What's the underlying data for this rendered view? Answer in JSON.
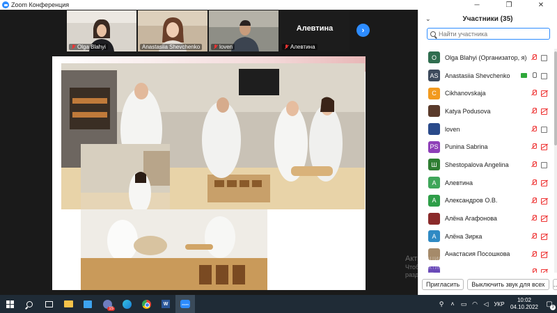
{
  "window": {
    "title": "Zoom Конференция",
    "minimize": "─",
    "restore": "❐",
    "close": "✕"
  },
  "thumbnails": [
    {
      "name": "Olga Blahyi",
      "muted": true
    },
    {
      "name": "Anastasiia Shevchenko",
      "muted": false,
      "active": true
    },
    {
      "name": "loven",
      "muted": true
    },
    {
      "name": "Алевтина",
      "display": "Алевтина",
      "muted": true
    }
  ],
  "next_button": "›",
  "participants": {
    "title": "Участники (35)",
    "collapse": "⌄",
    "search_placeholder": "Найти участника",
    "items": [
      {
        "initials": "O",
        "color": "#2f6d4f",
        "name": "Olga Blahyi (Организатор, я)",
        "mic": "off",
        "cam": "on"
      },
      {
        "initials": "AS",
        "color": "#3d4a5c",
        "name": "Anastasiia Shevchenko",
        "mic": "on",
        "cam": "on",
        "sharing": true
      },
      {
        "initials": "C",
        "color": "#f29a1f",
        "name": "Cikhanovskaja",
        "mic": "off",
        "cam": "off"
      },
      {
        "initials": "",
        "color": "#5a3a2a",
        "name": "Katya Podusova",
        "mic": "off",
        "cam": "off",
        "photo": true
      },
      {
        "initials": "",
        "color": "#2a4a8a",
        "name": "loven",
        "mic": "off",
        "cam": "on",
        "photo": true
      },
      {
        "initials": "PS",
        "color": "#8e3fb8",
        "name": "Punina Sabrina",
        "mic": "off",
        "cam": "off"
      },
      {
        "initials": "Ш",
        "color": "#2e7d32",
        "name": "Shestopalova Angelina",
        "mic": "off",
        "cam": "on"
      },
      {
        "initials": "А",
        "color": "#3fa65a",
        "name": "Алевтина",
        "mic": "off",
        "cam": "off"
      },
      {
        "initials": "А",
        "color": "#2e9e48",
        "name": "Александров О.В.",
        "mic": "off",
        "cam": "off"
      },
      {
        "initials": "",
        "color": "#8a2a2a",
        "name": "Алёна Агафонова",
        "mic": "off",
        "cam": "off",
        "photo": true
      },
      {
        "initials": "А",
        "color": "#2f8ac4",
        "name": "Алёна Зирка",
        "mic": "off",
        "cam": "off"
      },
      {
        "initials": "",
        "color": "#a58a6a",
        "name": "Анастасия Посошкова",
        "mic": "off",
        "cam": "off",
        "photo": true
      },
      {
        "initials": "",
        "color": "#6a4ab8",
        "name": "",
        "mic": "off",
        "cam": "off"
      }
    ],
    "invite_button": "Пригласить",
    "unmute_button": "Выключить звук для всех",
    "more_button": "…"
  },
  "watermark": {
    "line1": "Активация Windows",
    "line2": "Чтобы активировать Windows, перейдите в",
    "line3": "раздел \"Параметры\"."
  },
  "taskbar": {
    "badge": "15",
    "word": "W",
    "zoom": "zoom",
    "lang": "УКР",
    "time": "10:02",
    "date": "04.10.2022",
    "notifications": "3"
  },
  "colors": {
    "zoom_blue": "#2D8CFF",
    "muted_red": "#e33333",
    "active_outline": "#c6e36b",
    "taskbar": "#1f2b36"
  }
}
